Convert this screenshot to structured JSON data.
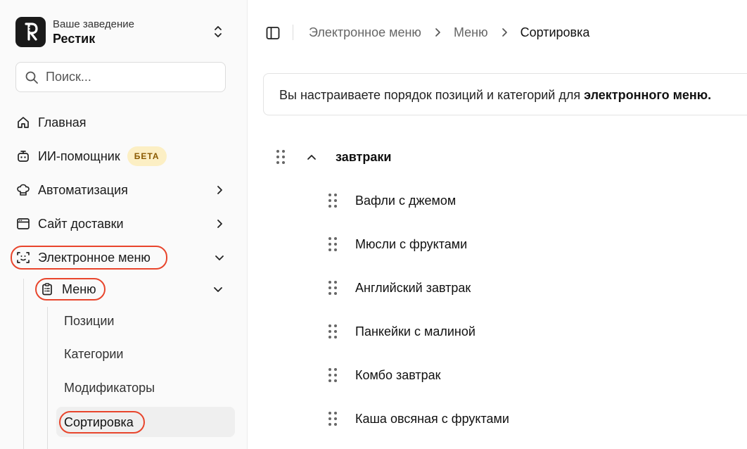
{
  "venue": {
    "caption": "Ваше заведение",
    "name": "Рестик"
  },
  "search": {
    "placeholder": "Поиск..."
  },
  "nav": {
    "home": "Главная",
    "assistant": "ИИ-помощник",
    "assistant_badge": "БЕТА",
    "automation": "Автоматизация",
    "delivery_site": "Сайт доставки",
    "emenu": "Электронное меню",
    "menu": "Меню",
    "sub": [
      "Позиции",
      "Категории",
      "Модификаторы",
      "Сортировка"
    ]
  },
  "breadcrumb": [
    "Электронное меню",
    "Меню",
    "Сортировка"
  ],
  "info": {
    "text": "Вы настраиваете порядок позиций и категорий для ",
    "bold": "электронного меню."
  },
  "category": {
    "name": "завтраки"
  },
  "items": [
    "Вафли с джемом",
    "Мюсли с фруктами",
    "Английский завтрак",
    "Панкейки с малиной",
    "Комбо завтрак",
    "Каша овсяная с фруктами"
  ],
  "colors": {
    "highlight": "#e8452c",
    "badge_bg": "#fcefc4",
    "badge_text": "#8a5a00"
  }
}
